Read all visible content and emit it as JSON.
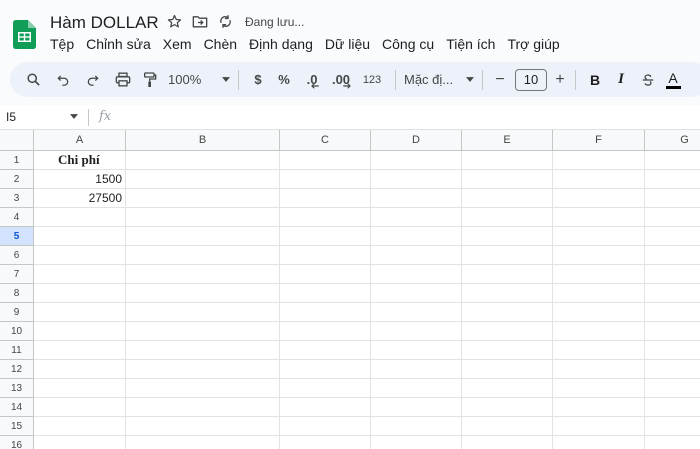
{
  "title": {
    "doc_name": "Hàm DOLLAR",
    "status": "Đang lưu..."
  },
  "menu": [
    "Tệp",
    "Chỉnh sửa",
    "Xem",
    "Chèn",
    "Định dạng",
    "Dữ liệu",
    "Công cụ",
    "Tiện ích",
    "Trợ giúp"
  ],
  "toolbar": {
    "zoom": "100%",
    "currency": "$",
    "percent": "%",
    "decrease_decimal": ".0",
    "increase_decimal": ".00",
    "number_format": "123",
    "font": "Mặc đị...",
    "font_size": "10",
    "minus": "−",
    "plus": "+",
    "bold": "B",
    "italic": "I",
    "text_color": "A"
  },
  "formula_bar": {
    "name_box": "I5",
    "fx": "fx"
  },
  "columns": [
    "A",
    "B",
    "C",
    "D",
    "E",
    "F",
    "G"
  ],
  "rows": [
    "1",
    "2",
    "3",
    "4",
    "5",
    "6",
    "7",
    "8",
    "9",
    "10",
    "11",
    "12",
    "13",
    "14",
    "15",
    "16"
  ],
  "selected_row": "5",
  "cells": {
    "A1": "Chi phí",
    "A2": "1500",
    "A3": "27500"
  },
  "colors": {
    "accent": "#0b57d0",
    "sheets_green": "#0f9d58",
    "toolbar_bg": "#edf2fa"
  }
}
